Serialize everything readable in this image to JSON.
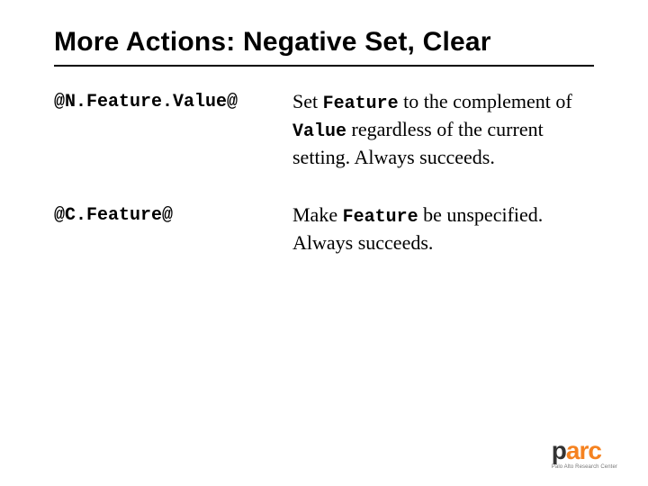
{
  "title": "More Actions: Negative Set, Clear",
  "rows": [
    {
      "code": "@N.Feature.Value@",
      "desc_pre": "Set ",
      "desc_kw1": "Feature",
      "desc_mid1": " to the complement of ",
      "desc_kw2": "Value",
      "desc_post": " regardless of the current setting. Always succeeds."
    },
    {
      "code": "@C.Feature@",
      "desc_pre": "Make ",
      "desc_kw1": "Feature",
      "desc_mid1": " be unspecified.  Always succeeds.",
      "desc_kw2": "",
      "desc_post": ""
    }
  ],
  "logo": {
    "p": "p",
    "arc": "arc",
    "sub": "Palo Alto Research Center"
  }
}
